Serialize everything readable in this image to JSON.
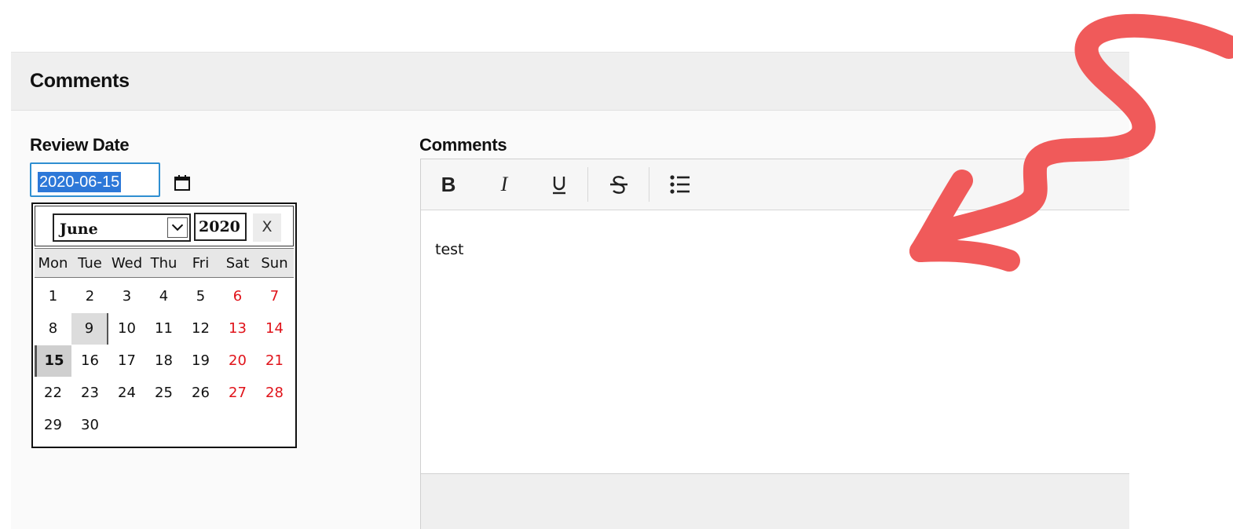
{
  "section": {
    "title": "Comments"
  },
  "review_date": {
    "label": "Review Date",
    "value": "2020-06-15"
  },
  "calendar": {
    "month": "June",
    "year": "2020",
    "close_label": "X",
    "weekdays": [
      "Mon",
      "Tue",
      "Wed",
      "Thu",
      "Fri",
      "Sat",
      "Sun"
    ],
    "weeks": [
      [
        "1",
        "2",
        "3",
        "4",
        "5",
        "6",
        "7"
      ],
      [
        "8",
        "9",
        "10",
        "11",
        "12",
        "13",
        "14"
      ],
      [
        "15",
        "16",
        "17",
        "18",
        "19",
        "20",
        "21"
      ],
      [
        "22",
        "23",
        "24",
        "25",
        "26",
        "27",
        "28"
      ],
      [
        "29",
        "30"
      ]
    ],
    "selected_day": "15",
    "highlighted_day": "9",
    "weekend_color": "#e0131a"
  },
  "comments": {
    "label": "Comments",
    "toolbar": {
      "bold_icon": "bold-icon",
      "italic_icon": "italic-icon",
      "underline_icon": "underline-icon",
      "strikethrough_icon": "strikethrough-icon",
      "bullet_list_icon": "bullet-list-icon"
    },
    "body_text": "test"
  },
  "annotation": {
    "arrow_color": "#f05a5a"
  }
}
